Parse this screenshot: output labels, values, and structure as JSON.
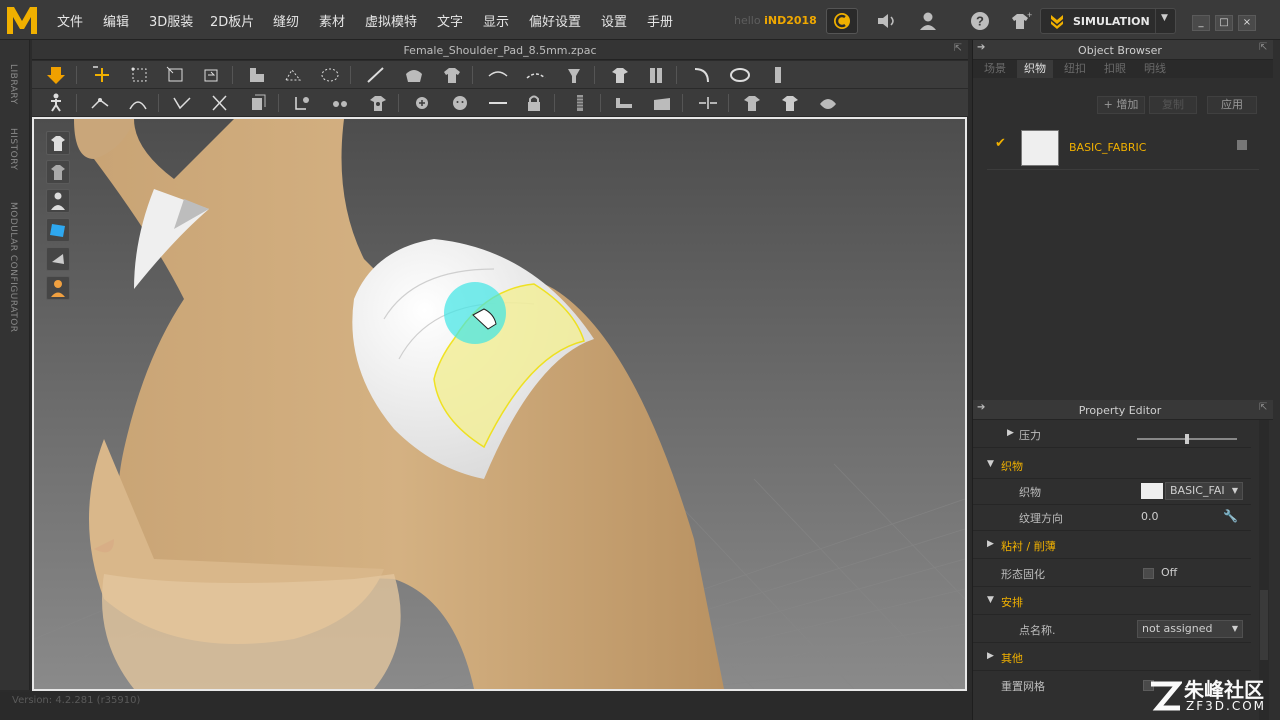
{
  "menu": {
    "items": [
      "文件",
      "编辑",
      "3D服装",
      "2D板片",
      "缝纫",
      "素材",
      "虚拟模特",
      "文字",
      "显示",
      "偏好设置",
      "设置",
      "手册"
    ]
  },
  "user": {
    "hello": "hello",
    "name": "iND2018"
  },
  "simulation": {
    "label": "SIMULATION"
  },
  "window": {
    "minimize": "_",
    "maximize": "□",
    "close": "×"
  },
  "left_tabs": [
    "LIBRARY",
    "HISTORY",
    "MODULAR CONFIGURATOR"
  ],
  "file_title": "Female_Shoulder_Pad_8.5mm.zpac",
  "object_browser": {
    "title": "Object Browser",
    "tabs": [
      "场景",
      "织物",
      "纽扣",
      "扣眼",
      "明线"
    ],
    "active_tab": 1,
    "actions": {
      "add": "+ 增加",
      "copy": "复制",
      "apply": "应用"
    },
    "fabric": {
      "name": "BASIC_FABRIC"
    }
  },
  "property_editor": {
    "title": "Property Editor",
    "rows": {
      "pressure": "压力",
      "fabric_section": "织物",
      "fabric_label": "织物",
      "fabric_value": "BASIC_FAI",
      "grain_label": "纹理方向",
      "grain_value": "0.0",
      "interlining_section": "粘衬 / 削薄",
      "solidify_label": "形态固化",
      "solidify_value": "Off",
      "arrange_section": "安排",
      "point_name_label": "点名称.",
      "point_name_value": "not assigned",
      "other_section": "其他",
      "reset_mesh_label": "重置网格"
    }
  },
  "status": {
    "version": "Version: 4.2.281 (r35910)"
  },
  "watermark": {
    "text": "朱峰社区",
    "url": "ZF3D.COM"
  },
  "colors": {
    "accent": "#f0b000",
    "pad_highlight": "#f3ef9a",
    "brush": "#3fe6e6"
  }
}
